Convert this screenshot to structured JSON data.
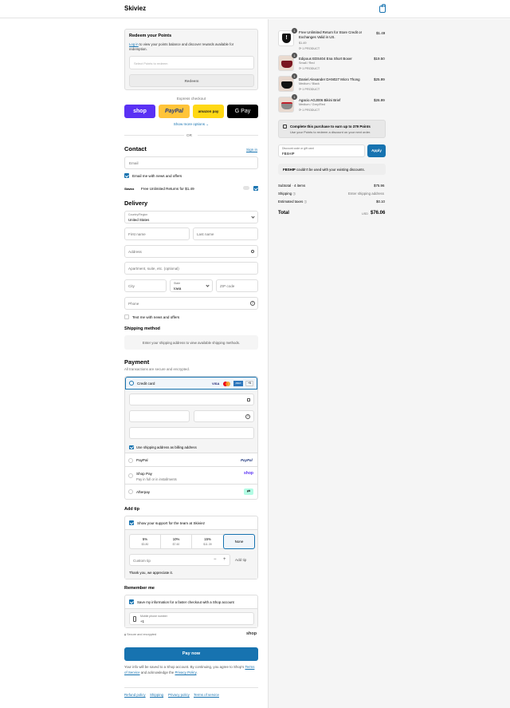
{
  "header": {
    "brand": "Skiviez"
  },
  "redeem": {
    "title": "Redeem your Points",
    "login_link": "Log in",
    "desc": " to view your points balance and discover rewards available for redemption.",
    "select_placeholder": "Select Points to redeem",
    "button": "Redeem"
  },
  "express": {
    "label": "Express checkout",
    "shop": "shop",
    "paypal": "PayPal",
    "amazon": "amazon pay",
    "gpay": "G Pay",
    "more": "Show more options",
    "or": "OR"
  },
  "contact": {
    "title": "Contact",
    "sign_in": "Sign in",
    "email_placeholder": "Email",
    "news": "Email me with news and offers",
    "return_logo": "Skiviez",
    "return_text": "Free Unlimited Returns for $1.49"
  },
  "delivery": {
    "title": "Delivery",
    "country_label": "Country/Region",
    "country": "United States",
    "first": "First name",
    "last": "Last name",
    "address": "Address",
    "apt": "Apartment, suite, etc. (optional)",
    "city": "City",
    "state_label": "State",
    "state": "Iowa",
    "zip": "ZIP code",
    "phone": "Phone",
    "text_me": "Text me with news and offers"
  },
  "shipping": {
    "title": "Shipping method",
    "msg": "Enter your shipping address to view available shipping methods."
  },
  "payment": {
    "title": "Payment",
    "subtitle": "All transactions are secure and encrypted.",
    "credit": "Credit card",
    "visa": "VISA",
    "amex": "AMEX",
    "more_cards": "+5",
    "billing": "Use shipping address as billing address",
    "paypal": "PayPal",
    "paypal_logo": "PayPal",
    "shoppay": "Shop Pay",
    "shoppay_sub": "Pay in full or in installments",
    "shop_logo": "shop",
    "afterpay": "Afterpay"
  },
  "tip": {
    "title": "Add tip",
    "support": "Show your support for the team at Skiviez",
    "options": [
      {
        "pct": "5%",
        "amt": "$3.80"
      },
      {
        "pct": "10%",
        "amt": "$7.60"
      },
      {
        "pct": "15%",
        "amt": "$11.39"
      },
      {
        "pct": "None",
        "amt": ""
      }
    ],
    "custom_placeholder": "Custom tip",
    "add": "Add tip",
    "thanks": "Thank you, we appreciate it."
  },
  "remember": {
    "title": "Remember me",
    "save": "Save my information for a faster checkout with a Shop account",
    "phone_label": "Mobile phone number",
    "phone_value": "+1",
    "secure": "Secure and encrypted",
    "shop": "shop"
  },
  "paynow": "Pay now",
  "terms": {
    "pre": "Your info will be saved to a Shop account. By continuing, you agree to Shop's ",
    "tos": "Terms of Service",
    "mid": " and acknowledge the ",
    "pp": "Privacy Policy",
    "end": "."
  },
  "footer": [
    "Refund policy",
    "Shipping",
    "Privacy policy",
    "Terms of service"
  ],
  "cart": {
    "items": [
      {
        "qty": "1",
        "name": "Free Unlimited Return for Store Credit or Exchanges Valid in US.",
        "variant": "$1.49",
        "sub": "1 PRODUCT",
        "price": "$1.49"
      },
      {
        "qty": "1",
        "name": "Edipous EDS404 Ena Short Boxer",
        "variant": "Small / Red",
        "sub": "1 PRODUCT",
        "price": "$19.50"
      },
      {
        "qty": "1",
        "name": "Daniel Alexander DAN027 Micro Thong",
        "variant": "Medium / Black",
        "sub": "1 PRODUCT",
        "price": "$25.99"
      },
      {
        "qty": "1",
        "name": "Agacio AGJ006 Bikini Brief",
        "variant": "Medium / Grey/Red",
        "sub": "1 PRODUCT",
        "price": "$26.99"
      }
    ],
    "points_title": "Complete this purchase to earn up to 379 Points",
    "points_sub": "Use your Points to redeem a discount on your next order.",
    "discount_label": "Discount code or gift card",
    "discount_value": "FBSHIP",
    "apply": "Apply",
    "err_code": "FBSHIP",
    "err_msg": " couldn't be used with your existing discounts.",
    "subtotal_label": "Subtotal · 4 items",
    "subtotal": "$75.96",
    "shipping_label": "Shipping",
    "shipping_value": "Enter shipping address",
    "tax_label": "Estimated taxes",
    "tax": "$0.10",
    "total_label": "Total",
    "currency": "USD",
    "total": "$76.06"
  },
  "colors": {
    "accent": "#1773b0",
    "shop": "#5a31f4",
    "paypal": "#ffc439",
    "amazon": "#ffd814",
    "gpay": "#000000"
  }
}
